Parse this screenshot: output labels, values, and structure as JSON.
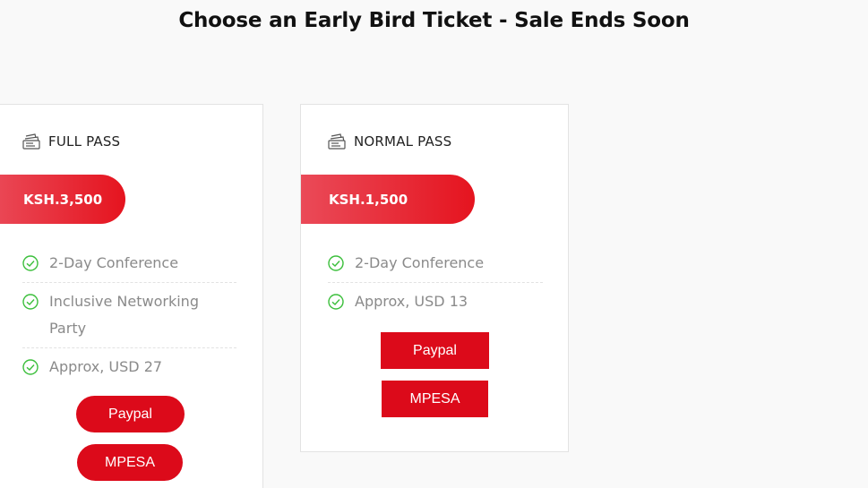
{
  "header": {
    "title": "Choose an Early Bird Ticket - Sale Ends Soon"
  },
  "tickets": [
    {
      "icon": "ticket-icon",
      "name": "FULL PASS",
      "price": "KSH.3,500",
      "features": [
        "2-Day Conference",
        "Inclusive Networking Party",
        "Approx, USD 27"
      ],
      "buttons": {
        "paypal": "Paypal",
        "mpesa": "MPESA"
      }
    },
    {
      "icon": "ticket-icon",
      "name": "NORMAL PASS",
      "price": "KSH.1,500",
      "features": [
        "2-Day Conference",
        "Approx, USD 13"
      ],
      "buttons": {
        "paypal": "Paypal",
        "mpesa": "MPESA"
      }
    }
  ],
  "colors": {
    "accent": "#dc0a1a",
    "check": "#3cbf3c",
    "text_muted": "#8a8a8a"
  }
}
